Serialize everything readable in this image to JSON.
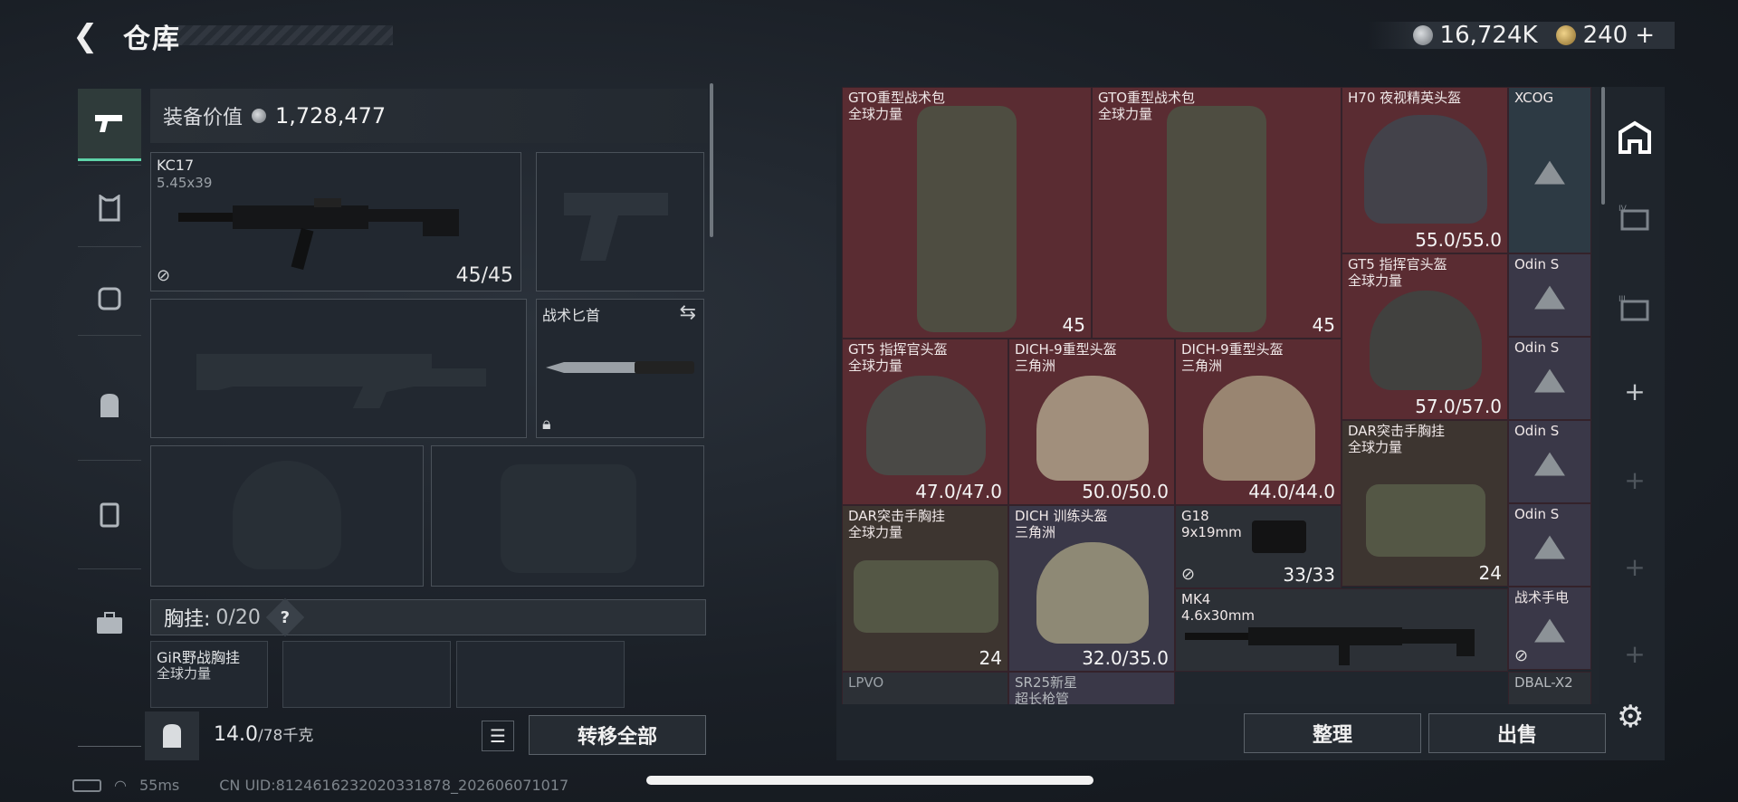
{
  "header": {
    "title": "仓库",
    "silver": "16,724K",
    "gold": "240",
    "gold_plus": "+"
  },
  "equipment": {
    "value_label": "装备价值",
    "value": "1,728,477",
    "primary": {
      "name": "KC17",
      "caliber": "5.45x39",
      "ammo": "45/45"
    },
    "knife": {
      "name": "战术匕首"
    },
    "chest_label": "胸挂:",
    "chest_count": "0/20",
    "chest_help": "?",
    "chest_item": {
      "name": "GiR野战胸挂",
      "sub": "全球力量"
    }
  },
  "footer": {
    "weight": "14.0",
    "weight_max": "/78千克",
    "transfer_all": "转移全部",
    "sort": "整理",
    "sell": "出售"
  },
  "storage": {
    "items": [
      {
        "name": "GTO重型战术包",
        "sub": "全球力量",
        "stat": "45"
      },
      {
        "name": "GTO重型战术包",
        "sub": "全球力量",
        "stat": "45"
      },
      {
        "name": "H70 夜视精英头盔",
        "sub": "",
        "stat": "55.0/55.0"
      },
      {
        "name": "XCOG",
        "sub": "",
        "stat": ""
      },
      {
        "name": "GT5 指挥官头盔",
        "sub": "全球力量",
        "stat": "57.0/57.0"
      },
      {
        "name": "Odin S",
        "sub": "",
        "stat": ""
      },
      {
        "name": "GT5 指挥官头盔",
        "sub": "全球力量",
        "stat": "47.0/47.0"
      },
      {
        "name": "DICH-9重型头盔",
        "sub": "三角洲",
        "stat": "50.0/50.0"
      },
      {
        "name": "DICH-9重型头盔",
        "sub": "三角洲",
        "stat": "44.0/44.0"
      },
      {
        "name": "Odin S",
        "sub": "",
        "stat": ""
      },
      {
        "name": "DAR突击手胸挂",
        "sub": "全球力量",
        "stat": "24"
      },
      {
        "name": "Odin S",
        "sub": "",
        "stat": ""
      },
      {
        "name": "DAR突击手胸挂",
        "sub": "全球力量",
        "stat": "24"
      },
      {
        "name": "DICH 训练头盔",
        "sub": "三角洲",
        "stat": "32.0/35.0"
      },
      {
        "name": "G18",
        "sub": "9x19mm",
        "stat": "33/33"
      },
      {
        "name": "Odin S",
        "sub": "",
        "stat": ""
      },
      {
        "name": "MK4",
        "sub": "4.6x30mm",
        "stat": ""
      },
      {
        "name": "战术手电",
        "sub": "",
        "stat": ""
      },
      {
        "name": "LPVO",
        "sub": "",
        "stat": ""
      },
      {
        "name": "SR25新星",
        "sub": "超长枪管",
        "stat": ""
      },
      {
        "name": "DBAL-X2",
        "sub": "",
        "stat": ""
      }
    ]
  },
  "status_bar": {
    "ping": "55ms",
    "uid": "CN UID:8124616232020331878_202606071017"
  },
  "colors": {
    "accent": "#5ed3a8",
    "red_rarity": "#5a2c32",
    "gold_rarity": "#3d3530",
    "purple_rarity": "#3a3848"
  }
}
